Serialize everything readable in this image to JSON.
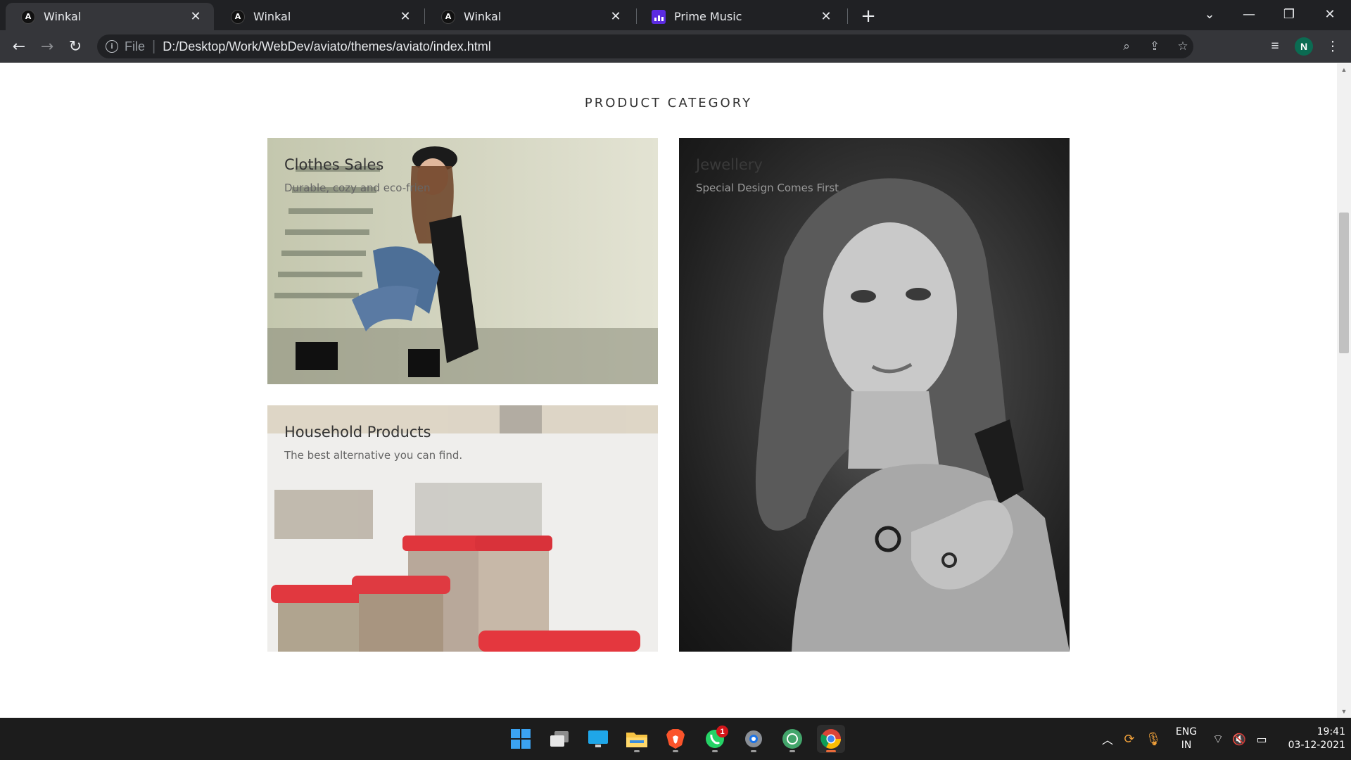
{
  "browser": {
    "tabs": [
      {
        "title": "Winkal",
        "favicon": "A",
        "active": true
      },
      {
        "title": "Winkal",
        "favicon": "A",
        "active": false
      },
      {
        "title": "Winkal",
        "favicon": "A",
        "active": false
      },
      {
        "title": "Prime Music",
        "favicon": "prime-music-icon",
        "active": false
      }
    ],
    "address": {
      "scheme": "File",
      "url": "D:/Desktop/Work/WebDev/aviato/themes/aviato/index.html"
    },
    "profile_initial": "N"
  },
  "page": {
    "section_title": "PRODUCT CATEGORY",
    "categories": [
      {
        "title": "Clothes Sales",
        "subtitle": "Durable, cozy and eco-frien",
        "image": "woman-sitting-on-steps-photo"
      },
      {
        "title": "Household Products",
        "subtitle": "The best alternative you can find.",
        "image": "red-lid-food-containers-photo"
      },
      {
        "title": "Jewellery",
        "subtitle": "Special Design Comes First",
        "image": "black-and-white-portrait-photo"
      }
    ]
  },
  "taskbar": {
    "apps": [
      "windows-start-icon",
      "task-view-icon",
      "desktop-icon",
      "file-explorer-icon",
      "brave-browser-icon",
      "whatsapp-icon",
      "settings-icon",
      "chatgpt-icon",
      "chrome-icon"
    ],
    "whatsapp_badge": "1",
    "language": "ENG",
    "region": "IN",
    "time": "19:41",
    "date": "03-12-2021"
  },
  "colors": {
    "chrome_dark": "#202124",
    "chrome_toolbar": "#35363a",
    "taskbar": "#1c1c1c",
    "page_bg": "#ffffff"
  }
}
